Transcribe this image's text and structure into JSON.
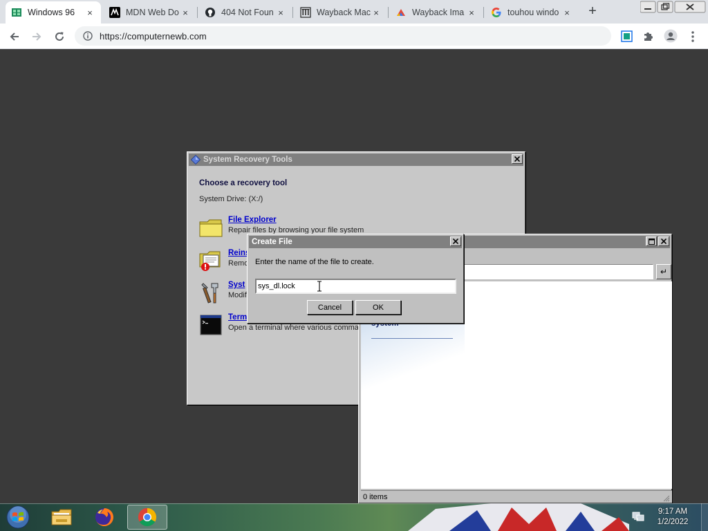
{
  "browser": {
    "tabs": [
      {
        "label": "Windows 96",
        "icon": "windows96-favicon-icon",
        "active": true
      },
      {
        "label": "MDN Web Do",
        "icon": "mdn-favicon-icon",
        "active": false
      },
      {
        "label": "404 Not Foun",
        "icon": "github-favicon-icon",
        "active": false
      },
      {
        "label": "Wayback Mac",
        "icon": "wayback-favicon-icon",
        "active": false
      },
      {
        "label": "Wayback Ima",
        "icon": "wayback-images-favicon-icon",
        "active": false
      },
      {
        "label": "touhou windo",
        "icon": "google-favicon-icon",
        "active": false
      }
    ],
    "tab_close": "×",
    "new_tab": "+",
    "url": "https://computernewb.com"
  },
  "recovery": {
    "title": "System Recovery Tools",
    "heading": "Choose a recovery tool",
    "drive": "System Drive: (X:/)",
    "tools": [
      {
        "name": "File Explorer",
        "desc": "Repair files by browsing your file system",
        "icon": "folder-icon"
      },
      {
        "name": "Reins",
        "desc": "Remo",
        "icon": "reinstall-icon"
      },
      {
        "name": "Syst",
        "desc": "Modif",
        "icon": "tools-icon"
      },
      {
        "name": "Term",
        "desc": "Open a terminal where various comma",
        "icon": "terminal-icon"
      }
    ]
  },
  "explorer": {
    "sidebar_title": "system",
    "status": "0 items",
    "go": "↵"
  },
  "create_file": {
    "title": "Create File",
    "prompt": "Enter the name of the file to create.",
    "value": "sys_dl.lock",
    "cancel": "Cancel",
    "ok": "OK"
  },
  "taskbar": {
    "time": "9:17 AM",
    "date": "1/2/2022",
    "apps": [
      "file-explorer-icon",
      "firefox-icon",
      "chrome-icon"
    ]
  },
  "colors": {
    "title_inactive": "#808080",
    "link": "#0000cc",
    "chrome_tabstrip": "#dee1e6"
  }
}
